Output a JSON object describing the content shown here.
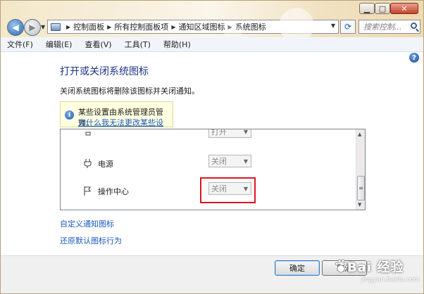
{
  "address": {
    "crumbs": [
      "控制面板",
      "所有控制面板项",
      "通知区域图标",
      "系统图标"
    ],
    "search_placeholder": "搜索控制..."
  },
  "menu": [
    "文件(F)",
    "编辑(E)",
    "查看(V)",
    "工具(T)",
    "帮助(H)"
  ],
  "page": {
    "title": "打开或关闭系统图标",
    "description": "关闭系统图标将删除该图标并关闭通知。"
  },
  "info": {
    "text": "某些设置由系统管理员管理。",
    "link": "为什么我无法更改某些设置?"
  },
  "rows": [
    {
      "label": "",
      "value": "打开"
    },
    {
      "label": "电源",
      "value": "关闭"
    },
    {
      "label": "操作中心",
      "value": "关闭"
    }
  ],
  "links": {
    "customize": "自定义通知图标",
    "restore": "还原默认图标行为"
  },
  "buttons": {
    "ok": "确定",
    "cancel": "取消"
  },
  "watermark": {
    "text": "Bai 经验",
    "sub": "jingyan.baidu.com"
  },
  "colors": {
    "title_blue": "#1e3287",
    "link_blue": "#1a59c1",
    "highlight_red": "#e0141e",
    "info_bg": "#ffffe1"
  }
}
